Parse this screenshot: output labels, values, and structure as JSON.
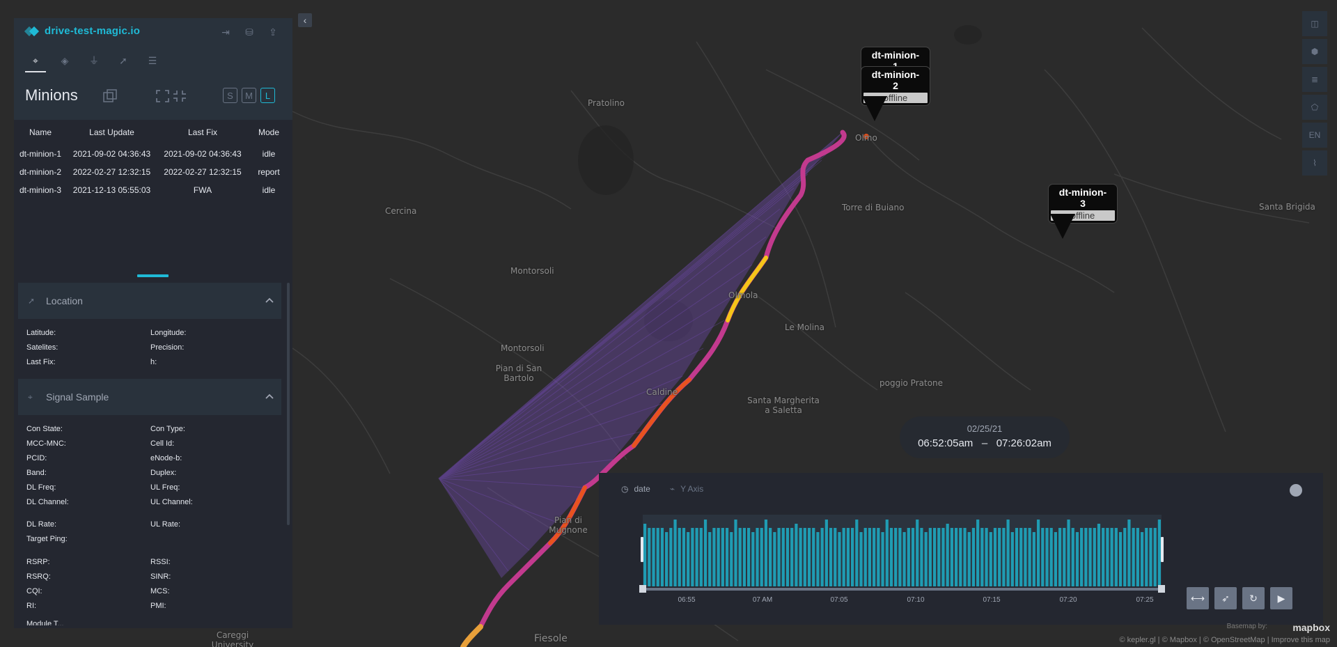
{
  "brand": {
    "name": "drive-test-magic.io"
  },
  "header": {
    "actions": [
      "sign-in-icon",
      "database-icon",
      "export-icon"
    ],
    "tabs": [
      {
        "icon": "router-icon",
        "active": true
      },
      {
        "icon": "layers-icon",
        "active": false
      },
      {
        "icon": "filter-icon",
        "active": false
      },
      {
        "icon": "cursor-icon",
        "active": false
      },
      {
        "icon": "sliders-icon",
        "active": false
      }
    ]
  },
  "minions": {
    "title": "Minions",
    "sizes": {
      "s": "S",
      "m": "M",
      "l": "L",
      "active": "L"
    },
    "columns": {
      "name": "Name",
      "last_update": "Last Update",
      "last_fix": "Last Fix",
      "mode": "Mode"
    },
    "rows": [
      {
        "name": "dt-minion-1",
        "last_update": "2021-09-02 04:36:43",
        "last_fix": "2021-09-02 04:36:43",
        "mode": "idle"
      },
      {
        "name": "dt-minion-2",
        "last_update": "2022-02-27 12:32:15",
        "last_fix": "2022-02-27 12:32:15",
        "mode": "report"
      },
      {
        "name": "dt-minion-3",
        "last_update": "2021-12-13 05:55:03",
        "last_fix": "FWA",
        "mode": "idle"
      }
    ]
  },
  "location": {
    "title": "Location",
    "fields": {
      "latitude": "Latitude:",
      "longitude": "Longitude:",
      "satelites": "Satelites:",
      "precision": "Precision:",
      "last_fix": "Last Fix:",
      "h": "h:"
    }
  },
  "signal": {
    "title": "Signal Sample",
    "fields": {
      "con_state": "Con State:",
      "con_type": "Con Type:",
      "mcc_mnc": "MCC-MNC:",
      "cell_id": "Cell Id:",
      "pcid": "PCID:",
      "enodeb": "eNode-b:",
      "band": "Band:",
      "duplex": "Duplex:",
      "dl_freq": "DL Freq:",
      "ul_freq": "UL Freq:",
      "dl_channel": "DL Channel:",
      "ul_channel": "UL Channel:",
      "dl_rate": "DL Rate:",
      "ul_rate": "UL Rate:",
      "target_ping": "Target Ping:",
      "rsrp": "RSRP:",
      "rssi": "RSSI:",
      "rsrq": "RSRQ:",
      "sinr": "SINR:",
      "cqi": "CQI:",
      "mcs": "MCS:",
      "ri": "RI:",
      "pmi": "PMI:",
      "module": "Module T..."
    }
  },
  "map": {
    "places": [
      "Pratolino",
      "Cercina",
      "Montorsoli",
      "Montorsoli",
      "Pian di San Bartolo",
      "Olmo",
      "Torre di Buiano",
      "Santa Brigida",
      "Le Molina",
      "poggio Pratone",
      "Santa Margherita a Saletta",
      "Fiesole",
      "Careggi University Hospital",
      "Caldine",
      "Olmola",
      "Pian di Mugnone"
    ],
    "markers": [
      {
        "name": "dt-minion-1",
        "status": "offline"
      },
      {
        "name": "dt-minion-2",
        "status": "offline"
      },
      {
        "name": "dt-minion-3",
        "status": "offline"
      }
    ],
    "right_tools": [
      "split-map-icon",
      "3d-cube-icon",
      "legend-icon",
      "draw-polygon-icon",
      "EN",
      "chart-icon"
    ],
    "colors": {
      "track_hot": "#f5c518",
      "track_mid": "#e8531f",
      "track_cool": "#c23a8e",
      "rays": "#7b4fc4"
    }
  },
  "time": {
    "date": "02/25/21",
    "start": "06:52:05am",
    "separator": "–",
    "end": "07:26:02am"
  },
  "timeline": {
    "x_label": "date",
    "y_label": "Y Axis",
    "ticks": [
      "06:55",
      "07 AM",
      "07:05",
      "07:10",
      "07:15",
      "07:20",
      "07:25"
    ],
    "controls": [
      "window-icon",
      "speed-icon",
      "loop-icon",
      "play-icon"
    ],
    "bar_color": "#1f9cb3"
  },
  "attribution": {
    "text": "© kepler.gl | © Mapbox | © OpenStreetMap | Improve this map",
    "basemap": "Basemap by:",
    "mapbox": "mapbox"
  }
}
